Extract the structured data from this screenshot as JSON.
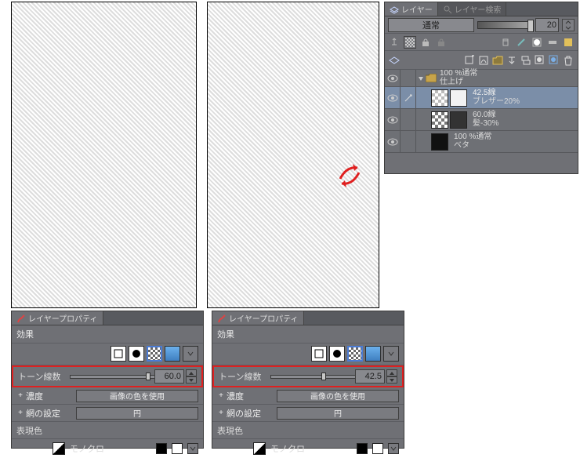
{
  "layers_panel": {
    "tab_layers": "レイヤー",
    "tab_search": "レイヤー検索",
    "blend_mode": "通常",
    "opacity": "20",
    "folder": {
      "mode": "100 %通常",
      "name": "仕上げ"
    },
    "layers": [
      {
        "thumb1": "check-light",
        "thumb2": "hair-light",
        "line1": "42.5線",
        "line2": "ブレザー20%",
        "selected": true
      },
      {
        "thumb1": "check-dark",
        "thumb2": "hair-dark",
        "line1": "60.0線",
        "line2": "髪-30%",
        "selected": false
      },
      {
        "thumb1": "beta-thumb",
        "thumb2": "",
        "line1": "100 %通常",
        "line2": "ベタ",
        "selected": false
      }
    ]
  },
  "prop_panels": {
    "title": "レイヤープロパティ",
    "effect_label": "効果",
    "tone_lines_label": "トーン線数",
    "density_label": "濃度",
    "density_value": "画像の色を使用",
    "halftone_label": "網の設定",
    "halftone_value": "円",
    "display_color_label": "表現色",
    "display_color_value": "モノクロ",
    "left": {
      "tone_lines_value": "60.0"
    },
    "right": {
      "tone_lines_value": "42.5"
    }
  }
}
